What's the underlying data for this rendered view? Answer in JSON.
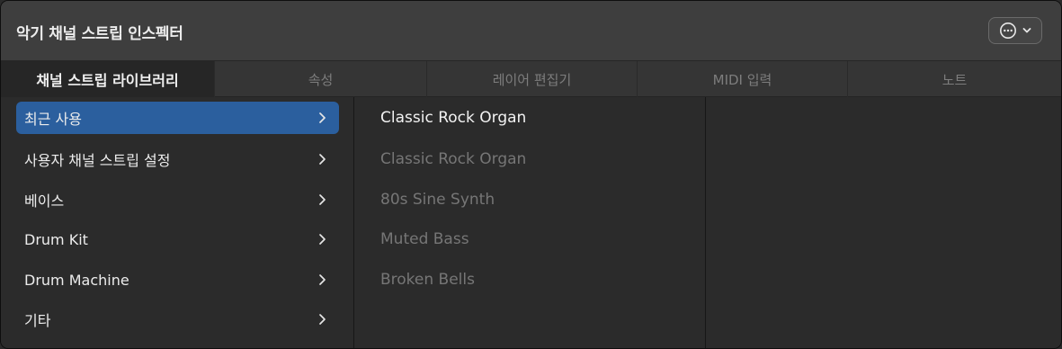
{
  "window": {
    "title": "악기 채널 스트립 인스펙터"
  },
  "tabs": [
    {
      "label": "채널 스트립 라이브러리",
      "active": true
    },
    {
      "label": "속성",
      "active": false
    },
    {
      "label": "레이어 편집기",
      "active": false
    },
    {
      "label": "MIDI 입력",
      "active": false
    },
    {
      "label": "노트",
      "active": false
    }
  ],
  "categories": [
    {
      "label": "최근 사용",
      "selected": true
    },
    {
      "label": "사용자 채널 스트립 설정",
      "selected": false
    },
    {
      "label": "베이스",
      "selected": false
    },
    {
      "label": "Drum Kit",
      "selected": false
    },
    {
      "label": "Drum Machine",
      "selected": false
    },
    {
      "label": "기타",
      "selected": false
    }
  ],
  "patches": [
    {
      "label": "Classic Rock Organ",
      "active": true
    },
    {
      "label": "Classic Rock Organ",
      "active": false
    },
    {
      "label": "80s Sine Synth",
      "active": false
    },
    {
      "label": "Muted Bass",
      "active": false
    },
    {
      "label": "Broken Bells",
      "active": false
    }
  ],
  "icons": {
    "action_menu": "ellipsis-circle-icon",
    "dropdown": "chevron-down-icon",
    "category_disclosure": "chevron-right-icon"
  },
  "colors": {
    "selection": "#2b5f9e",
    "background": "#2b2b2b",
    "titlebar": "#3e3e3e"
  }
}
